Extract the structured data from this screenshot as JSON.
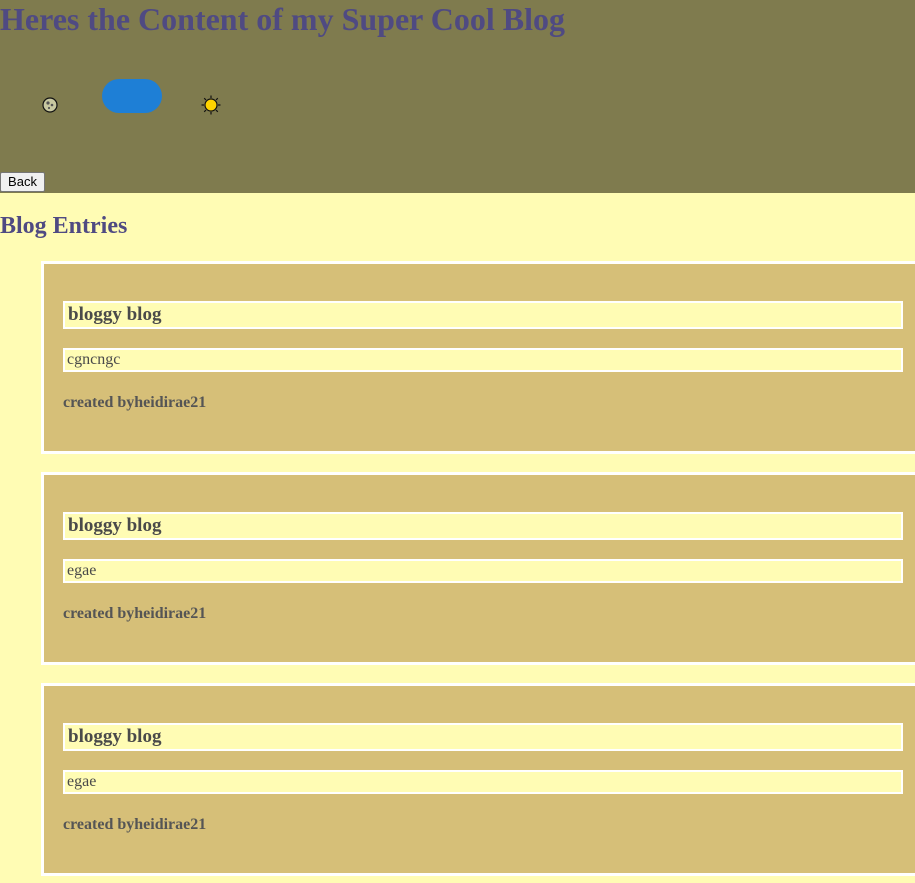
{
  "header": {
    "title": "Heres the Content of my Super Cool Blog",
    "theme_toggle": {
      "left_icon": "moon-icon",
      "right_icon": "sun-icon",
      "accent_color": "#1e7fd6"
    },
    "back_label": "Back"
  },
  "main": {
    "section_title": "Blog Entries",
    "entries": [
      {
        "title": "bloggy blog",
        "body": "cgncngc",
        "author": "created byheidirae21"
      },
      {
        "title": "bloggy blog",
        "body": "egae",
        "author": "created byheidirae21"
      },
      {
        "title": "bloggy blog",
        "body": "egae",
        "author": "created byheidirae21"
      }
    ]
  },
  "colors": {
    "header_bg": "#7f7b4e",
    "page_bg": "#fffcb4",
    "card_bg": "#d6bf78",
    "heading_text": "#4f4a82"
  }
}
